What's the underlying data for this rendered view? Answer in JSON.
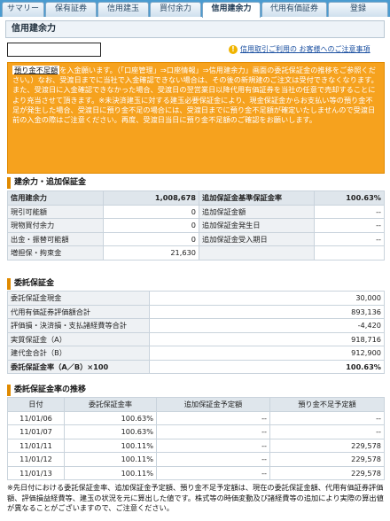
{
  "tabs": [
    "サマリー",
    "保有証券",
    "信用建玉",
    "買付余力",
    "信用建余力",
    "代用有価証券",
    "登録"
  ],
  "active_tab_index": 4,
  "page_title": "信用建余力",
  "notice_link": "信用取引ご利用の お客様へのご注意事項",
  "warning": {
    "tag": "預り金不足額",
    "text": "を入金願います。（「口座管理」⇒口座情報」⇒信用建余力」画面の委託保証金の推移をご参照ください。）なお、受渡日までに当社で入金確認できない場合は、その後の新規建のご注文は受付できなくなります。また、受渡日に入金確認できなかった場合、受渡日の翌営業日以降代用有価証券を当社の任意で売却することにより充当させて頂きます。※未決済建玉に対する建玉必要保証金により、現金保証金からお支払い等の預り金不足が発生した場合、受渡日に預り金不足の場合には、受渡日までに預り金不足額が確定いたしませんので受渡日前の入金の際はご注意ください。再度、受渡日当日に預り金不足額のご確認をお願いします。"
  },
  "section1": {
    "title": "建余力・追加保証金",
    "rows": [
      {
        "l1": "信用建余力",
        "v1": "1,008,678",
        "l2": "追加保証金基準保証金率",
        "v2": "100.63%",
        "header": true
      },
      {
        "l1": "現引可能額",
        "v1": "0",
        "l2": "追加保証金額",
        "v2": "--"
      },
      {
        "l1": "現物買付余力",
        "v1": "0",
        "l2": "追加保証金発生日",
        "v2": "--"
      },
      {
        "l1": "出金・振替可能額",
        "v1": "0",
        "l2": "追加保証金受入期日",
        "v2": "--"
      },
      {
        "l1": "増担保・拘束金",
        "v1": "21,630",
        "l2": "",
        "v2": ""
      }
    ]
  },
  "section2": {
    "title": "委託保証金",
    "rows": [
      {
        "label": "委託保証金現金",
        "value": "30,000"
      },
      {
        "label": "代用有価証券評価額合計",
        "value": "893,136"
      },
      {
        "label": "評価損・決済損・支払諸経費等合計",
        "value": "-4,420"
      },
      {
        "label": "実質保証金（A）",
        "value": "918,716"
      },
      {
        "label": "建代金合計（B）",
        "value": "912,900"
      },
      {
        "label": "委託保証金率（A／B）×100",
        "value": "100.63%",
        "bold": true
      }
    ]
  },
  "section3": {
    "title": "委託保証金率の推移",
    "headers": [
      "日付",
      "委託保証金率",
      "追加保証金予定額",
      "預り金不足予定額"
    ],
    "rows": [
      [
        "11/01/06",
        "100.63%",
        "--",
        "--"
      ],
      [
        "11/01/07",
        "100.63%",
        "--",
        "--"
      ],
      [
        "11/01/11",
        "100.11%",
        "--",
        "229,578"
      ],
      [
        "11/01/12",
        "100.11%",
        "--",
        "229,578"
      ],
      [
        "11/01/13",
        "100.11%",
        "--",
        "229,578"
      ]
    ]
  },
  "footnote": "※先日付における委託保証金率、追加保証金予定額、預り金不足予定額は、現在の委託保証金額、代用有価証券評価額、評価損益経費等、建玉の状況を元に算出した値です。株式等の時価変動及び諸経費等の追加により実際の算出値が異なることがございますので、ご注意ください。"
}
